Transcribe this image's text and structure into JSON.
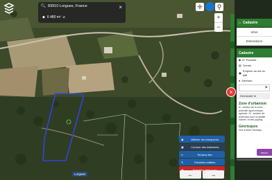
{
  "search": {
    "address": "83910 Lorgues, France",
    "area": "6 480 m²",
    "close_icon": "close-icon"
  },
  "place_label": "Lorgues",
  "layers": {
    "items": [
      {
        "label": "Afficher les marqueurs",
        "icon": "eye-icon",
        "color": "#1e5fa8"
      },
      {
        "label": "Contour des bâtiments",
        "icon": "building-icon",
        "color": "#2b3e55"
      },
      {
        "label": "Terrains liés",
        "icon": "link-icon",
        "color": "#1e5fa8"
      },
      {
        "label": "Parcelles éditées",
        "icon": "edit-icon",
        "color": "#1e5fa8"
      },
      {
        "label": "Parcelles déjà vues",
        "icon": "eye-icon",
        "color": "#c62828"
      }
    ]
  },
  "nav": {
    "prev": "←",
    "next": "→"
  },
  "panel": {
    "header": "Cadastre",
    "tabs": [
      "Infos",
      "Estimations",
      ""
    ],
    "cadastre_title": "Cadastre",
    "info_rows": [
      "N° Parcelle :",
      "Terrain",
      "Emprise au sol du bâti",
      "Adresse :"
    ],
    "request_button": "Demander le",
    "zone_title": "Zone d'urbanism",
    "zone_text": "N - secteur de la zone, potentiel agronomique, agricole / N - secteur de protection pour la qualité naturel, et des paysag",
    "geo_title": "Géorisques",
    "geo_text": "Voir la fiche Géorisqu",
    "import_label": "Impor"
  },
  "zoom": {
    "plus": "+",
    "minus": "−"
  },
  "colors": {
    "accent": "#2e7d32",
    "danger": "#e53935",
    "parcel_outline": "#3344dd"
  }
}
